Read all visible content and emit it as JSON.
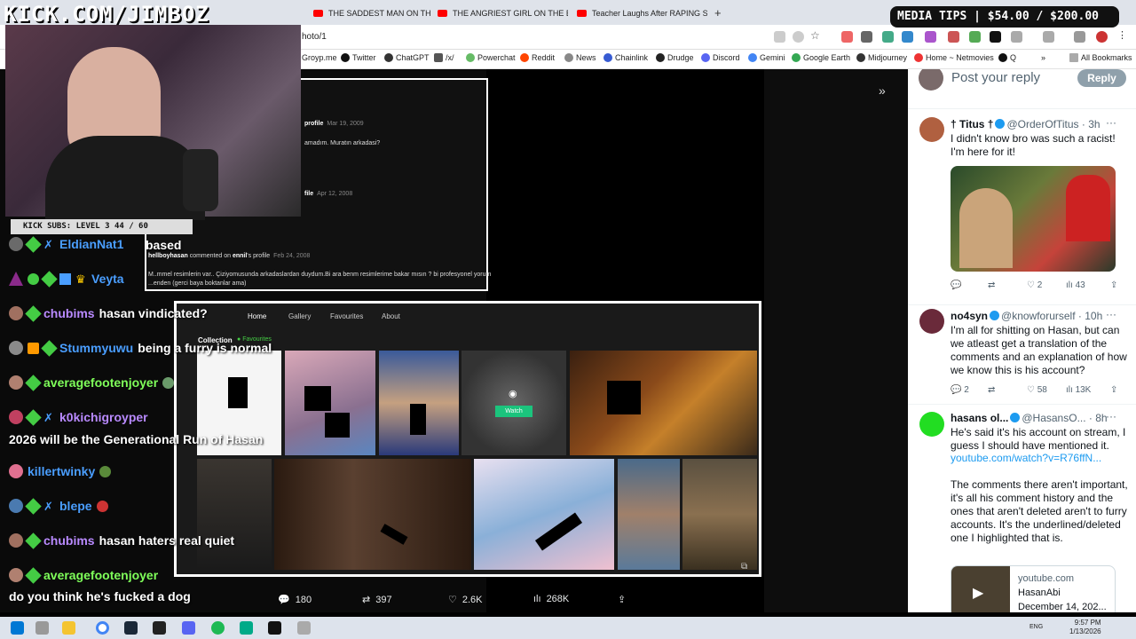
{
  "browser": {
    "tabs": [
      {
        "label": "THE SADDEST MAN ON THE PL"
      },
      {
        "label": "THE ANGRIEST GIRL ON THE E"
      },
      {
        "label": "Teacher Laughs After RAPING S"
      }
    ],
    "url": "hoto/1",
    "bookmarks": [
      "Groyp.me",
      "Twitter",
      "ChatGPT",
      "/x/",
      "Powerchat",
      "Reddit",
      "News",
      "Chainlink",
      "Drudge",
      "Discord",
      "Gemini",
      "Google Earth",
      "Midjourney",
      "Home ~ Netmovies",
      "Q"
    ],
    "all_bookmarks": "All Bookmarks"
  },
  "stream": {
    "logo": "KICK.COM/JIMBOZ",
    "subs_goal": "KICK SUBS: LEVEL 3 44 / 60",
    "media_tips": "MEDIA TIPS | $54.00 / $200.00"
  },
  "comments_popup": {
    "rows": [
      {
        "author": "profile",
        "date": "Mar 19, 2009",
        "text": "amadım. Muratın arkadasi?"
      },
      {
        "author": "file",
        "date": "Apr 12, 2008",
        "text": ""
      },
      {
        "author": "hellboyhasan",
        "action": "commented on",
        "target": "ennil",
        "suffix": "'s profile",
        "date": "Feb 24, 2008",
        "text": "M..mmel resimlerin var.. Çiziyomusunda arkadaslardan duydum.Bi ara benm resimlerime bakar mısın ? bi profesyonel yorum",
        "text2": "...enden (gerci baya boktanlar ama)"
      }
    ]
  },
  "gallery": {
    "nav": [
      "Home",
      "Gallery",
      "Favourites",
      "About"
    ],
    "collection_label": "Collection",
    "favourites_tab": "Favourites",
    "watch_label": "Watch"
  },
  "chat": [
    {
      "user": "",
      "msg": "based",
      "color": "#ffffff"
    },
    {
      "user": "EldianNat1",
      "msg": "",
      "color": "#4a9eff"
    },
    {
      "user": "Veyta",
      "msg": "",
      "color": "#4a9eff"
    },
    {
      "user": "chubims",
      "msg": "hasan vindicated?",
      "color": "#b98aff"
    },
    {
      "user": "Stummyuwu",
      "msg": "being a furry is normal",
      "color": "#4a9eff"
    },
    {
      "user": "averagefootenjoyer",
      "msg": "",
      "color": "#7fff5a"
    },
    {
      "user": "k0kichigroyper",
      "msg": "",
      "color": "#b98aff"
    },
    {
      "user": "",
      "msg": "2026 will be the Generational Run of Hasan",
      "color": "#ffffff"
    },
    {
      "user": "killertwinky",
      "msg": "",
      "color": "#4a9eff"
    },
    {
      "user": "blepe",
      "msg": "",
      "color": "#4a9eff"
    },
    {
      "user": "chubims",
      "msg": "hasan haters real quiet",
      "color": "#b98aff"
    },
    {
      "user": "averagefootenjoyer",
      "msg": "",
      "color": "#7fff5a"
    },
    {
      "user": "",
      "msg": "do you think he's fucked a dog",
      "color": "#ffffff"
    }
  ],
  "post_stats": {
    "replies": "180",
    "reposts": "397",
    "likes": "2.6K",
    "views": "268K"
  },
  "twitter": {
    "post_reply_placeholder": "Post your reply",
    "reply_button": "Reply",
    "replies": [
      {
        "name": "† Titus †",
        "handle": "@OrderOfTitus · 3h",
        "text": "I didn't know bro was such a racist! I'm here for it!",
        "stats": {
          "replies": "",
          "reposts": "",
          "likes": "2",
          "views": "43"
        }
      },
      {
        "name": "no4syn",
        "handle": "@knowforurself · 10h",
        "text": "I'm all for shitting on Hasan, but can we atleast get a translation of the comments and an explanation of how we know this is his account?",
        "stats": {
          "replies": "2",
          "reposts": "",
          "likes": "58",
          "views": "13K"
        }
      },
      {
        "name": "hasans ol...",
        "handle": "@HasansO... · 8h",
        "text": "He's said it's his account on stream, I guess I should have mentioned it.",
        "link": "youtube.com/watch?v=R76ffN...",
        "text2": "The comments there aren't important, it's all his comment history and the ones that aren't deleted aren't to furry accounts. It's the underlined/deleted one I highlighted that is.",
        "card": {
          "domain": "youtube.com",
          "title": "HasanAbi",
          "date": "December 14, 202..."
        }
      }
    ]
  },
  "taskbar": {
    "lang": "ENG",
    "time": "9:57 PM",
    "date": "1/13/2026"
  }
}
